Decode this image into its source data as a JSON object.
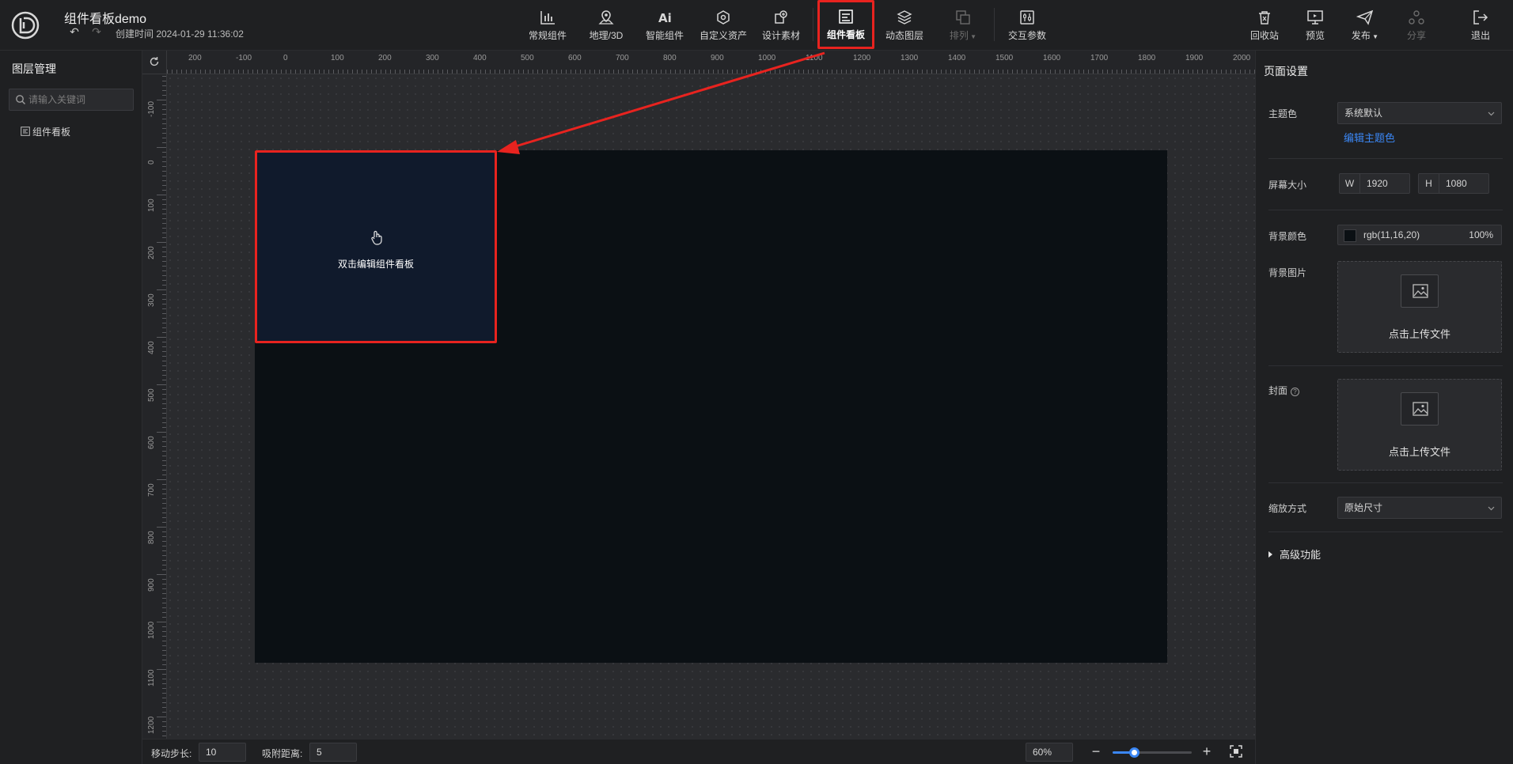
{
  "header": {
    "title": "组件看板demo",
    "created": "创建时间 2024-01-29 11:36:02",
    "tools": [
      {
        "label": "常规组件",
        "icon": "bar-chart-icon"
      },
      {
        "label": "地理/3D",
        "icon": "map-pin-icon"
      },
      {
        "label": "智能组件",
        "icon": "ai-icon"
      },
      {
        "label": "自定义资产",
        "icon": "hexagon-icon"
      },
      {
        "label": "设计素材",
        "icon": "design-material-icon"
      },
      {
        "label": "组件看板",
        "icon": "board-icon"
      },
      {
        "label": "动态图层",
        "icon": "layers-icon"
      },
      {
        "label": "排列",
        "icon": "arrange-icon"
      },
      {
        "label": "交互参数",
        "icon": "sliders-icon"
      },
      {
        "label": "回收站",
        "icon": "trash-icon"
      },
      {
        "label": "预览",
        "icon": "monitor-icon"
      },
      {
        "label": "发布",
        "icon": "send-icon"
      },
      {
        "label": "分享",
        "icon": "share-icon"
      },
      {
        "label": "退出",
        "icon": "exit-icon"
      }
    ]
  },
  "left": {
    "title": "图层管理",
    "search_placeholder": "请输入关键词",
    "layers": [
      "组件看板"
    ]
  },
  "canvas": {
    "ruler_x": [
      "200",
      "-100",
      "0",
      "100",
      "200",
      "300",
      "400",
      "500",
      "600",
      "700",
      "800",
      "900",
      "1000",
      "1100",
      "1200",
      "1300",
      "1400",
      "1500",
      "1600",
      "1700",
      "1800",
      "1900",
      "2000"
    ],
    "ruler_y": [
      "-100",
      "0",
      "100",
      "200",
      "300",
      "400",
      "500",
      "600",
      "700",
      "800",
      "900",
      "1000",
      "1100",
      "1200"
    ],
    "board_text": "双击编辑组件看板"
  },
  "bottom": {
    "move_step_label": "移动步长:",
    "move_step_value": "10",
    "snap_label": "吸附距离:",
    "snap_value": "5",
    "zoom": "60%",
    "zoom_fraction": 0.27
  },
  "right": {
    "title": "页面设置",
    "theme_label": "主题色",
    "theme_value": "系统默认",
    "theme_link": "编辑主题色",
    "screen_label": "屏幕大小",
    "w_key": "W",
    "w_value": "1920",
    "h_key": "H",
    "h_value": "1080",
    "bg_color_label": "背景颜色",
    "bg_color_value": "rgb(11,16,20)",
    "bg_color_opacity": "100%",
    "bg_image_label": "背景图片",
    "upload_text": "点击上传文件",
    "cover_label": "封面",
    "cover_upload_text": "点击上传文件",
    "scale_label": "缩放方式",
    "scale_value": "原始尺寸",
    "advanced_label": "高级功能"
  },
  "colors": {
    "accent": "#3b87f5",
    "highlight": "#e8231f",
    "screen_bg": "#0b1014"
  }
}
